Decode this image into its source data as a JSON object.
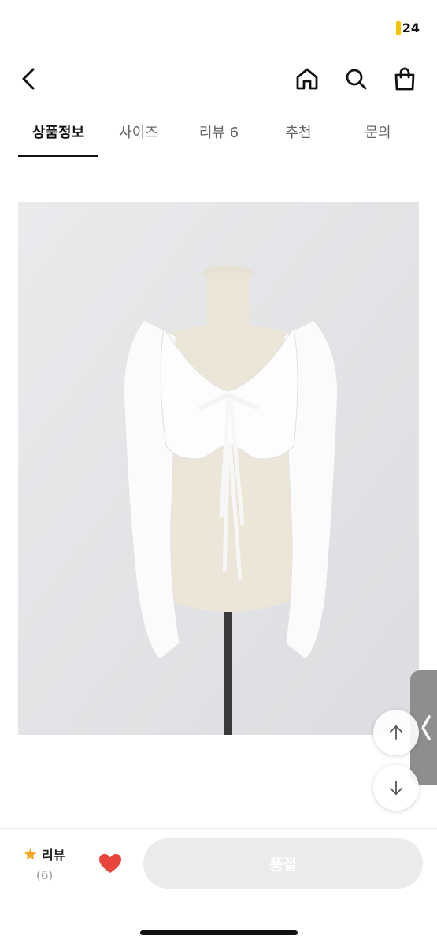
{
  "status": {
    "battery": "24",
    "battery_color": "#f5c400"
  },
  "nav": {
    "back_icon": "chevron-left-icon",
    "home_icon": "home-icon",
    "search_icon": "search-icon",
    "bag_icon": "shopping-bag-icon"
  },
  "tabs": [
    {
      "label": "상품정보",
      "active": true
    },
    {
      "label": "사이즈",
      "active": false
    },
    {
      "label": "리뷰 6",
      "active": false
    },
    {
      "label": "추천",
      "active": false
    },
    {
      "label": "문의",
      "active": false
    }
  ],
  "floating": {
    "up_icon": "arrow-up-icon",
    "down_icon": "arrow-down-icon",
    "side_icon": "chevron-left-icon"
  },
  "bottom": {
    "review_label": "리뷰",
    "review_count": "(6)",
    "star_color": "#f4a623",
    "heart_color": "#e8453c",
    "soldout_label": "품절"
  }
}
